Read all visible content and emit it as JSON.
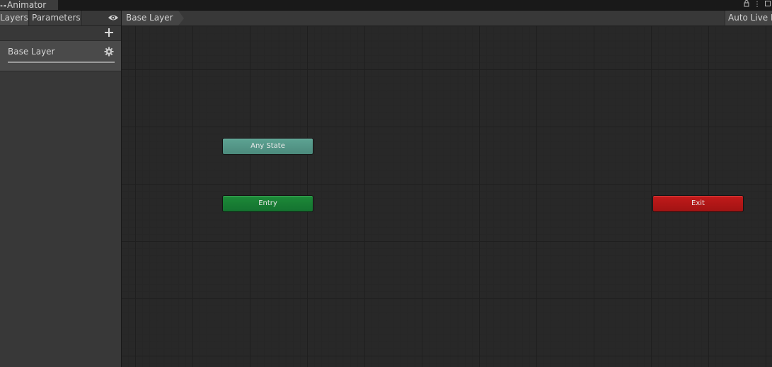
{
  "window": {
    "title": "Animator",
    "title_icon": "animator-icon",
    "controls": [
      "lock-icon",
      "kebab-menu-icon",
      "maximize-icon"
    ]
  },
  "toolbar": {
    "tabs": [
      {
        "label": "Layers",
        "active": true
      },
      {
        "label": "Parameters",
        "active": false
      }
    ],
    "eye_icon": "eye-icon",
    "breadcrumb": "Base Layer",
    "auto_live_label": "Auto Live L"
  },
  "layers_panel": {
    "add_icon": "plus-icon",
    "layers": [
      {
        "name": "Base Layer",
        "settings_icon": "gear-icon"
      }
    ]
  },
  "graph": {
    "nodes": [
      {
        "label": "Any State",
        "kind": "any-state",
        "color": "#5da393"
      },
      {
        "label": "Entry",
        "kind": "entry",
        "color": "#1d8a38"
      },
      {
        "label": "Exit",
        "kind": "exit",
        "color": "#c21a1a"
      }
    ]
  }
}
